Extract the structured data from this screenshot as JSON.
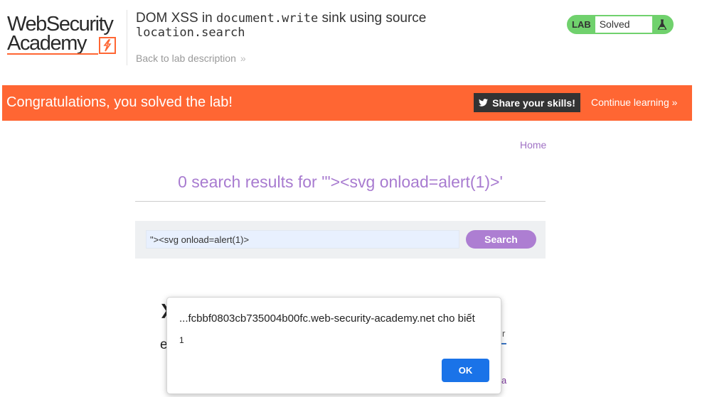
{
  "header": {
    "logo_line1": "WebSecurity",
    "logo_line2": "Academy",
    "title_prefix": "DOM XSS in ",
    "title_code1": "document.write",
    "title_middle": " sink using source",
    "title_code2": "location.search",
    "back_link": "Back to lab description",
    "back_chevron": "»"
  },
  "lab_badge": {
    "label": "LAB",
    "status": "Solved",
    "icon": "flask-icon",
    "color": "#70d16d"
  },
  "banner": {
    "message": "Congratulations, you solved the lab!",
    "share_label": "Share your skills!",
    "share_icon": "twitter-icon",
    "continue_label": "Continue learning",
    "continue_chevron": "»",
    "color": "#ff6633"
  },
  "main": {
    "home_link": "Home",
    "results_heading": "0 search results for '\"><svg onload=alert(1)>'",
    "search": {
      "value": "\"><svg onload=alert(1)>",
      "button_label": "Search"
    }
  },
  "background_fragments": {
    "frag1": "❯",
    "frag2": "e",
    "frag3": "r",
    "frag4": "a"
  },
  "dialog": {
    "origin": "...fcbbf0803cb735004b00fc.web-security-academy.net cho biết",
    "message": "1",
    "ok_label": "OK"
  }
}
